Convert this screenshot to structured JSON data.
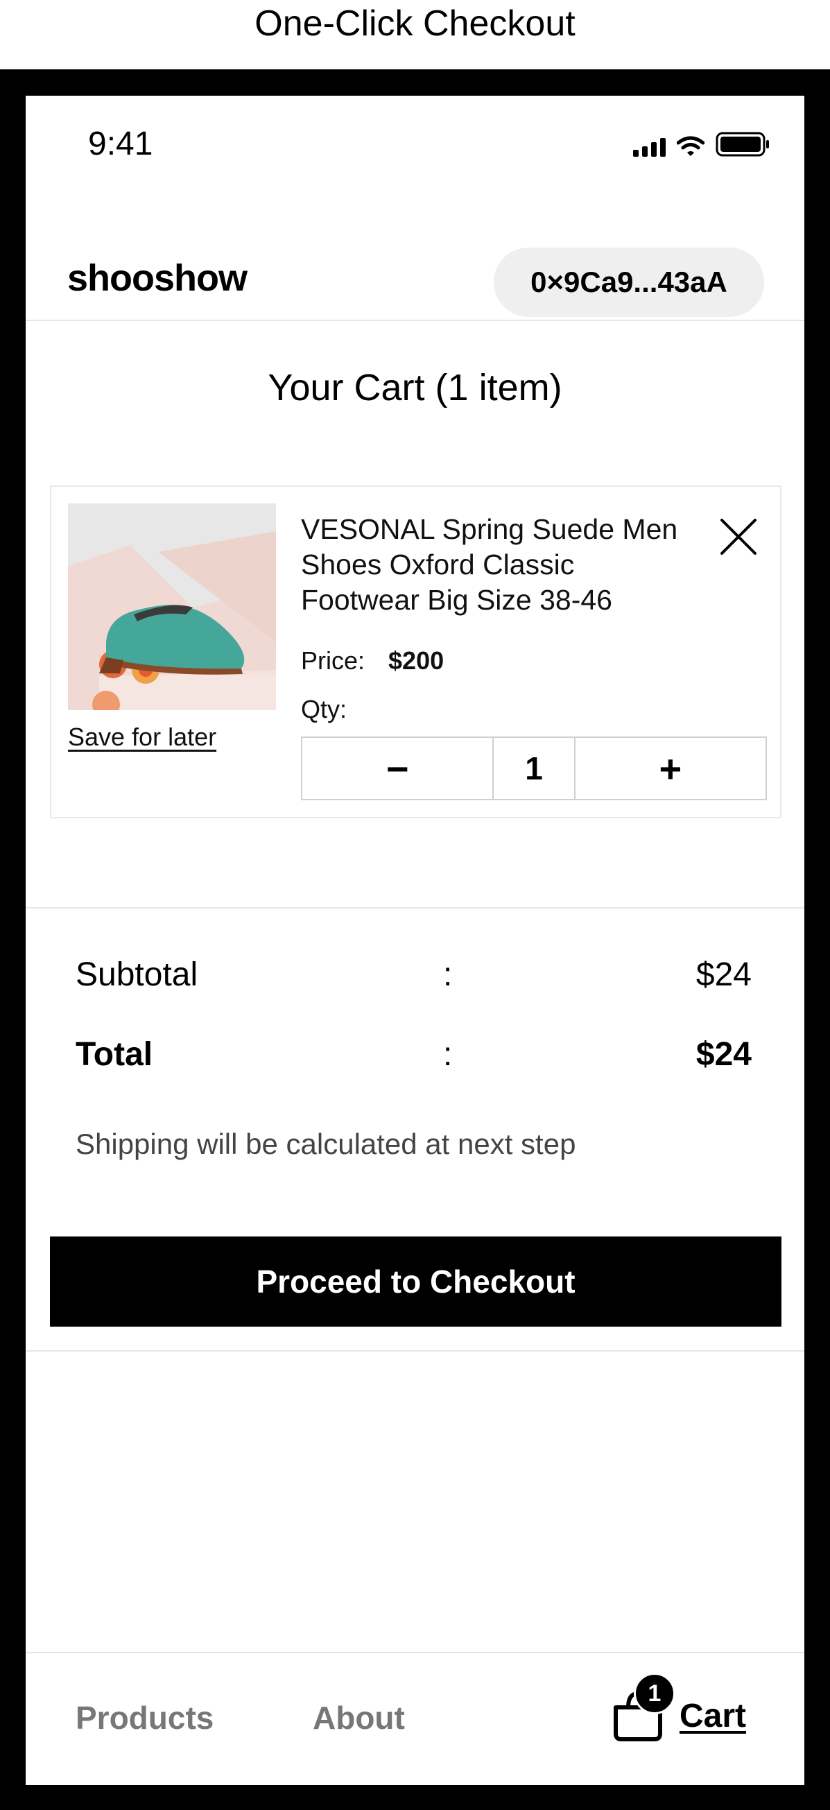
{
  "caption": "One-Click Checkout",
  "status_bar": {
    "time": "9:41",
    "icons": [
      "signal-icon",
      "wifi-icon",
      "battery-icon"
    ]
  },
  "header": {
    "brand": "shooshow",
    "wallet_address": "0×9Ca9...43aA"
  },
  "cart": {
    "title": "Your Cart (1 item)",
    "items": [
      {
        "title": "VESONAL Spring Suede Men Shoes Oxford Classic Footwear Big Size 38-46",
        "price_label": "Price:",
        "price": "$200",
        "qty_label": "Qty:",
        "qty": "1",
        "decrement": "−",
        "increment": "+",
        "save_for_later": "Save for later",
        "image": "green-suede-oxford-shoe"
      }
    ]
  },
  "summary": {
    "subtotal_label": "Subtotal",
    "subtotal_colon": ":",
    "subtotal_value": "$24",
    "total_label": "Total",
    "total_colon": ":",
    "total_value": "$24",
    "shipping_note": "Shipping will be calculated at next step"
  },
  "checkout_button": "Proceed to Checkout",
  "nav": {
    "products": "Products",
    "about": "About",
    "cart": "Cart",
    "cart_count": "1"
  },
  "colors": {
    "primary": "#000000",
    "muted": "#777777",
    "wallet_bg": "#efefef",
    "divider": "#e6e6e6"
  }
}
